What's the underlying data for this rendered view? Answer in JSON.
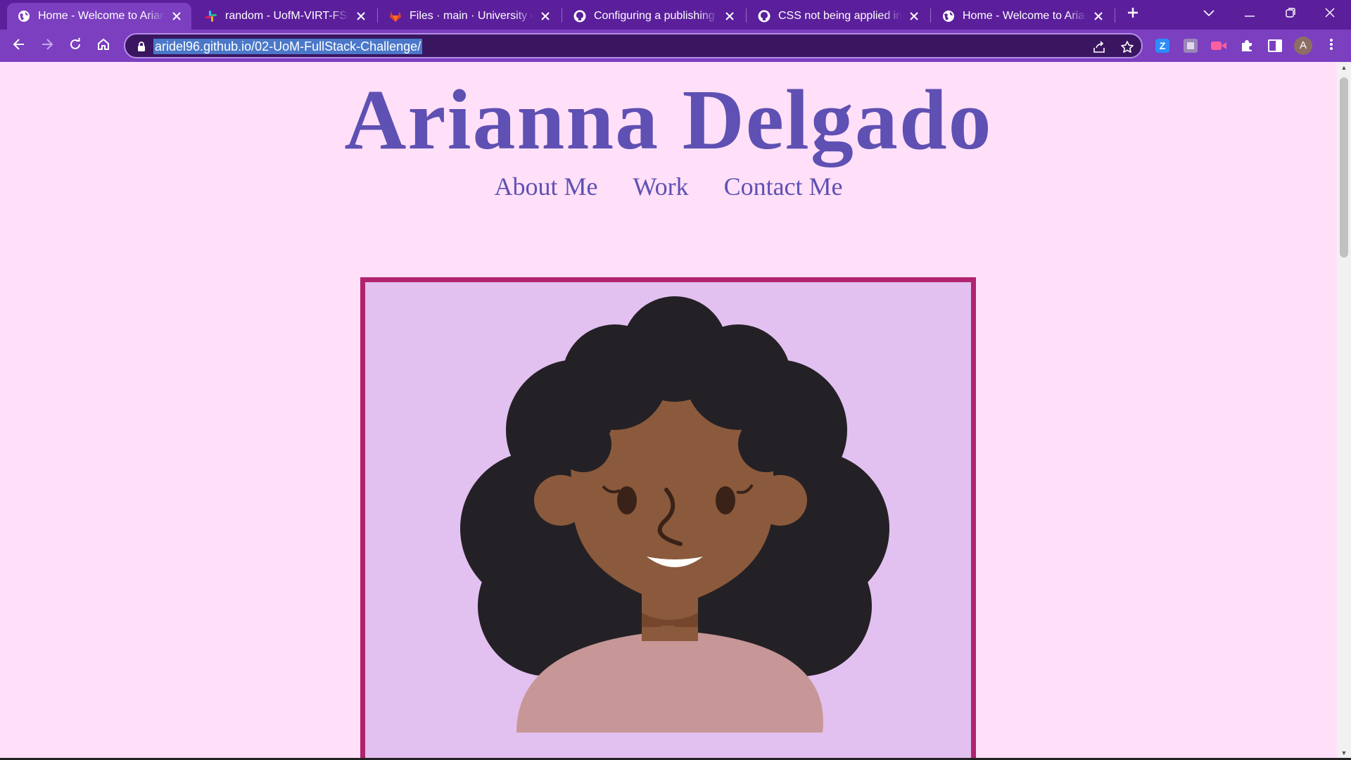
{
  "browser": {
    "tabs": [
      {
        "title": "Home - Welcome to Arianna Delgado",
        "favicon": "globe-icon",
        "active": true
      },
      {
        "title": "random - UofM-VIRT-FSF-PT",
        "favicon": "slack-icon",
        "active": false
      },
      {
        "title": "Files · main · University of Minnesota",
        "favicon": "gitlab-icon",
        "active": false
      },
      {
        "title": "Configuring a publishing source",
        "favicon": "github-icon",
        "active": false
      },
      {
        "title": "CSS not being applied in pages",
        "favicon": "github-icon",
        "active": false
      },
      {
        "title": "Home - Welcome to Arianna Delgado",
        "favicon": "globe-icon",
        "active": false
      }
    ],
    "new_tab_icon": "plus-icon",
    "address": {
      "url": "aridel96.github.io/02-UoM-FullStack-Challenge/"
    },
    "profile_initial": "A",
    "extensions": [
      "zoom-icon",
      "extension-box-icon",
      "screen-record-icon",
      "puzzle-icon"
    ],
    "colors": {
      "frame": "#5b1f9c",
      "toolbar": "#7b3fc0",
      "omnibox": "#3a1660",
      "selection": "#4b78c9"
    }
  },
  "page": {
    "title": "Arianna Delgado",
    "nav": [
      "About Me",
      "Work",
      "Contact Me"
    ],
    "hero_image": "avatar-illustration",
    "colors": {
      "background": "#ffe0f8",
      "accent_text": "#5f50b3",
      "frame_border": "#b0246e",
      "frame_bg": "#e2c1f0"
    }
  }
}
